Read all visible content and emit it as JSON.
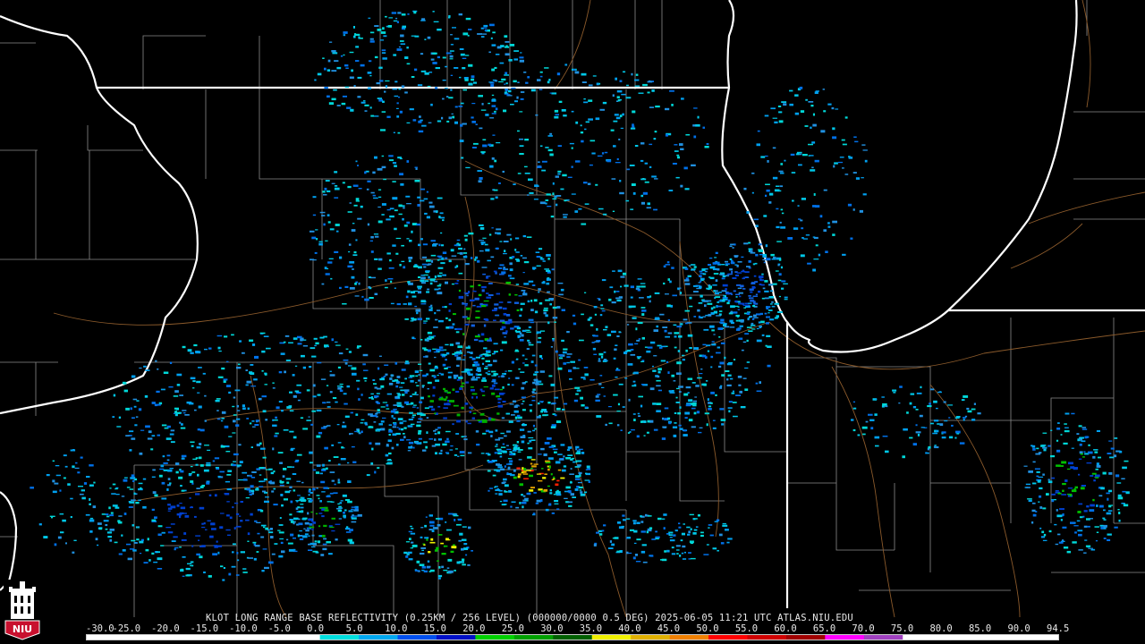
{
  "product": {
    "caption": "KLOT LONG RANGE BASE REFLECTIVITY (0.25KM / 256 LEVEL) (000000/0000 0.5 DEG) 2025-06-05 11:21 UTC  ATLAS.NIU.EDU"
  },
  "logo": {
    "text": "NIU",
    "icon": "university-tower-icon",
    "color": "#c8102e"
  },
  "scale": {
    "labels": [
      "-30.0",
      "-25.0",
      "-20.0",
      "-15.0",
      "-10.0",
      "-5.0",
      "0.0",
      "5.0",
      "10.0",
      "15.0",
      "20.0",
      "25.0",
      "30.0",
      "35.0",
      "40.0",
      "45.0",
      "50.0",
      "55.0",
      "60.0",
      "65.0",
      "70.0",
      "75.0",
      "80.0",
      "85.0",
      "90.0",
      "94.5"
    ],
    "colors": [
      "#ffffff",
      "#ffffff",
      "#ffffff",
      "#ffffff",
      "#ffffff",
      "#ffffff",
      "#00e0e0",
      "#00a8f0",
      "#0050f0",
      "#0010c8",
      "#00d000",
      "#00a000",
      "#006000",
      "#f0f000",
      "#e0b000",
      "#f08000",
      "#ff0000",
      "#d00000",
      "#a00000",
      "#ff00ff",
      "#a040c0",
      "#ffffff",
      "#ffffff",
      "#ffffff",
      "#ffffff"
    ]
  },
  "map": {
    "background": "#000000",
    "state_line_color": "#ffffff",
    "county_line_color": "#8a8a8a",
    "road_color": "#8b5a2b"
  }
}
